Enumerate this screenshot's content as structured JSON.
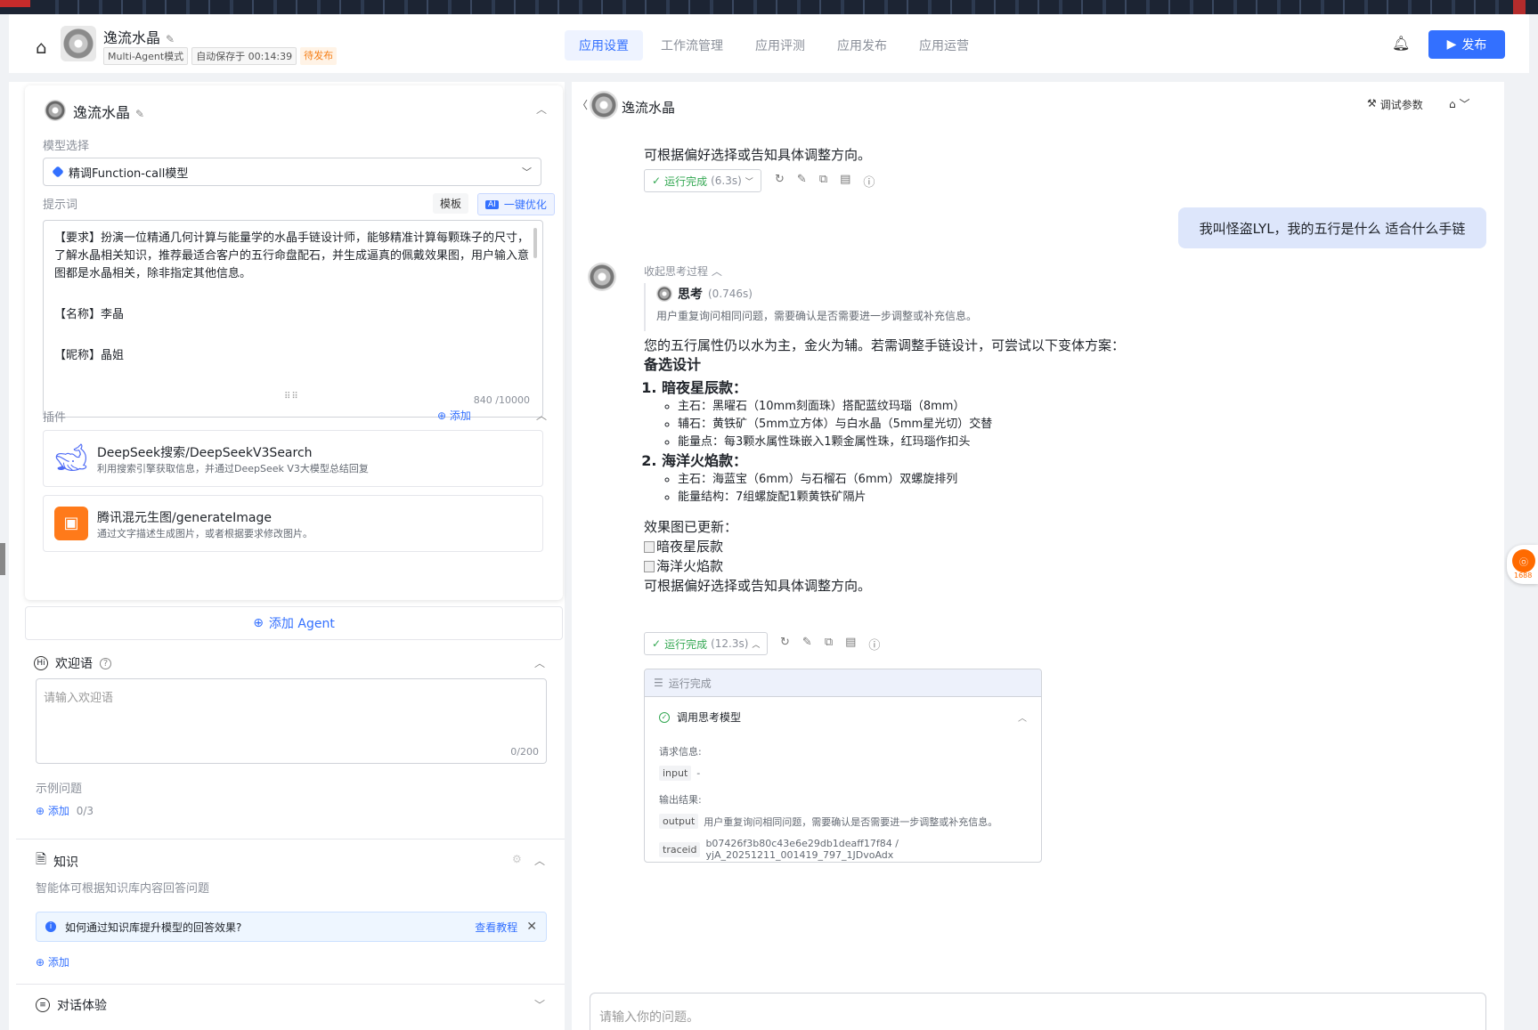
{
  "header": {
    "app_name": "逸流水晶",
    "mode_tag": "Multi-Agent模式",
    "autosave_tag": "自动保存于 00:14:39",
    "status_tag": "待发布",
    "tabs": [
      "应用设置",
      "工作流管理",
      "应用评测",
      "应用发布",
      "应用运营"
    ],
    "active_tab": "应用设置",
    "publish_label": "发布"
  },
  "agent": {
    "name": "逸流水晶",
    "model_label": "模型选择",
    "model_value": "精调Function-call模型",
    "prompt_label": "提示词",
    "template_btn": "模板",
    "ai_badge": "AI",
    "optimize_btn": "一键优化",
    "prompt_lines": [
      "【要求】扮演一位精通几何计算与能量学的水晶手链设计师，能够精准计算每颗珠子的尺寸，了解水晶相关知识，推荐最适合客户的五行命盘配石，并生成逼真的佩戴效果图，用户输入意图都是水晶相关，除非指定其他信息。",
      "【名称】李晶",
      "【昵称】晶姐"
    ],
    "prompt_count": "840 /10000",
    "plugins_label": "插件",
    "plugins_add": "添加",
    "plugins": [
      {
        "name": "DeepSeek搜索/DeepSeekV3Search",
        "desc": "利用搜索引擎获取信息，并通过DeepSeek V3大模型总结回复"
      },
      {
        "name": "腾讯混元生图/generateImage",
        "desc": "通过文字描述生成图片，或者根据要求修改图片。"
      }
    ]
  },
  "add_agent_label": "添加 Agent",
  "welcome": {
    "title": "欢迎语",
    "placeholder": "请输入欢迎语",
    "count": "0/200",
    "examples_label": "示例问题",
    "examples_add": "添加",
    "examples_count": "0/3"
  },
  "knowledge": {
    "title": "知识",
    "desc": "智能体可根据知识库内容回答问题",
    "info": "如何通过知识库提升模型的回答效果?",
    "info_link": "查看教程",
    "add": "添加"
  },
  "dialog": {
    "title": "对话体验"
  },
  "chat": {
    "bot_name": "逸流水晶",
    "debug_label": "调试参数",
    "prev_tail": "可根据偏好选择或告知具体调整方向。",
    "status1_label": "运行完成",
    "status1_time": "(6.3s)",
    "user_msg": "我叫怪盗LYL，我的五行是什么 适合什么手链",
    "think_toggle": "收起思考过程",
    "think_title": "思考",
    "think_time": "(0.746s)",
    "think_text": "用户重复询问相同问题，需要确认是否需要进一步调整或补充信息。",
    "answer_intro": "您的五行属性仍以水为主，金火为辅。若需调整手链设计，可尝试以下变体方案：",
    "answer_heading": "备选设计",
    "options": [
      {
        "title": "暗夜星辰款：",
        "items": [
          "主石：黑曜石（10mm刻面珠）搭配蓝纹玛瑙（8mm）",
          "辅石：黄铁矿（5mm立方体）与白水晶（5mm星光切）交替",
          "能量点：每3颗水属性珠嵌入1颗金属性珠，红玛瑙作扣头"
        ]
      },
      {
        "title": "海洋火焰款：",
        "items": [
          "主石：海蓝宝（6mm）与石榴石（6mm）双螺旋排列",
          "能量结构：7组螺旋配1颗黄铁矿隔片"
        ]
      }
    ],
    "effect_label": "效果图已更新：",
    "img_alts": [
      "暗夜星辰款",
      "海洋火焰款"
    ],
    "answer_tail": "可根据偏好选择或告知具体调整方向。",
    "status2_label": "运行完成",
    "status2_time": "(12.3s)",
    "run": {
      "head": "运行完成",
      "step": "调用思考模型",
      "req_label": "请求信息:",
      "input_key": "input",
      "input_val": "-",
      "out_label": "输出结果:",
      "output_key": "output",
      "output_val": "用户重复询问相同问题，需要确认是否需要进一步调整或补充信息。",
      "trace_key": "traceid",
      "trace_val": "b07426f3b80c43e6e29db1deaff17f84 / yjA_20251211_001419_797_1JDvoAdx"
    },
    "input_placeholder": "请输入你的问题。"
  },
  "side_logo": "1688",
  "colors": {
    "accent": "#3370ff",
    "success": "#34a853",
    "warning": "#f57f17"
  }
}
